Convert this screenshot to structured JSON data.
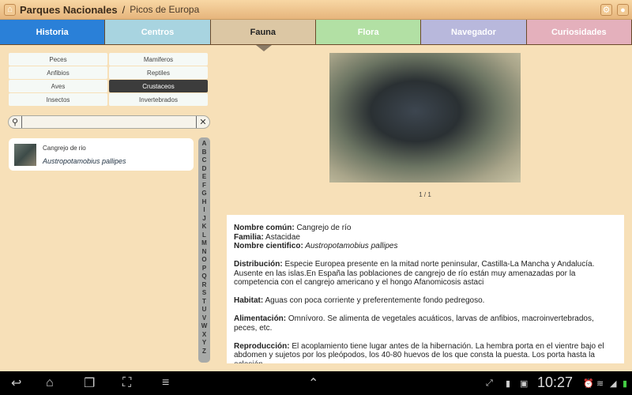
{
  "header": {
    "title": "Parques Nacionales",
    "separator": "/",
    "subtitle": "Picos de Europa",
    "home_icon": "⌂",
    "settings_icon": "⚙",
    "user_icon": "👤"
  },
  "tabs": [
    {
      "label": "Historia",
      "color": "#2a80d8"
    },
    {
      "label": "Centros",
      "color": "#a8d4e0"
    },
    {
      "label": "Fauna",
      "color": "#dcc7a4",
      "active": true
    },
    {
      "label": "Flora",
      "color": "#b2e0a4"
    },
    {
      "label": "Navegador",
      "color": "#b8b8dc"
    },
    {
      "label": "Curiosidades",
      "color": "#e4b0bc"
    }
  ],
  "categories": [
    "Peces",
    "Mamiferos",
    "Anfibios",
    "Reptiles",
    "Aves",
    "Crustaceos",
    "Insectos",
    "Invertebrados"
  ],
  "selected_category": "Crustaceos",
  "search": {
    "value": "",
    "search_icon": "⚲",
    "clear_icon": "✕"
  },
  "results": [
    {
      "name": "Cangrejo de rio",
      "scientific": "Austropotamobius pallipes"
    }
  ],
  "alphabet": [
    "A",
    "B",
    "C",
    "D",
    "E",
    "F",
    "G",
    "H",
    "I",
    "J",
    "K",
    "L",
    "M",
    "N",
    "O",
    "P",
    "Q",
    "R",
    "S",
    "T",
    "U",
    "V",
    "W",
    "X",
    "Y",
    "Z"
  ],
  "pager": "1 / 1",
  "detail": [
    {
      "label": "Nombre común:",
      "text": " Cangrejo de río"
    },
    {
      "label": "Familia:",
      "text": " Astacidae"
    },
    {
      "label": "Nombre cientifico:",
      "text": " Austropotamobius pallipes"
    },
    {
      "label": "Distribución:",
      "text": " Especie Europea presente en la mitad norte peninsular, Castilla-La Mancha y Andalucía. Ausente en las islas.En España las poblaciones de cangrejo de río están muy amenazadas por la competencia con el cangrejo americano y el hongo Afanomicosis astaci"
    },
    {
      "label": "Habitat:",
      "text": " Aguas con poca corriente y preferentemente fondo pedregoso."
    },
    {
      "label": "Alimentación:",
      "text": " Omnívoro. Se alimenta de vegetales acuáticos, larvas de anfibios, macroinvertebrados, peces, etc."
    },
    {
      "label": "Reproducción:",
      "text": " El acoplamiento tiene lugar antes de la hibernación. La hembra porta en el vientre bajo el abdomen y sujetos por los pleópodos, los 40-80 huevos de los que consta la puesta. Los porta hasta la eclosión."
    }
  ],
  "status": {
    "time": "10:27"
  }
}
